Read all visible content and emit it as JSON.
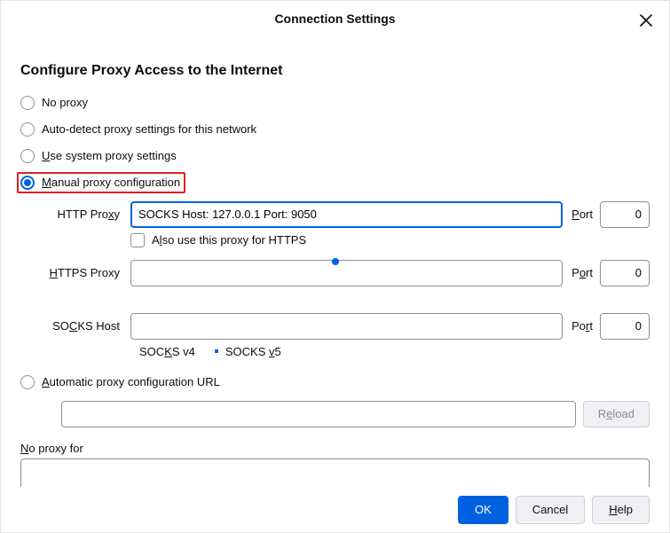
{
  "title": "Connection Settings",
  "section_title": "Configure Proxy Access to the Internet",
  "radios": {
    "noproxy": "No proxy",
    "autodetect": "Auto-detect proxy settings for this network",
    "system_pre": "U",
    "system_post": "se system proxy settings",
    "manual_pre": "M",
    "manual_post": "anual proxy configuration",
    "auto_pac_pre": "A",
    "auto_pac_post": "utomatic proxy configuration URL"
  },
  "http": {
    "label_pre": "HTTP Pro",
    "label_u": "x",
    "label_post": "y",
    "value": "SOCKS Host: 127.0.0.1 Port: 9050",
    "port_label_u": "P",
    "port_label_post": "ort",
    "port": "0"
  },
  "also_https": {
    "pre": "A",
    "u": "l",
    "post": "so use this proxy for HTTPS"
  },
  "https": {
    "label_u": "H",
    "label_post": "TTPS Proxy",
    "value": "",
    "port_label_pre": "P",
    "port_label_u": "o",
    "port_label_post": "rt",
    "port": "0"
  },
  "socks": {
    "label_pre": "SO",
    "label_u": "C",
    "label_post": "KS Host",
    "value": "",
    "port_label_pre": "Po",
    "port_label_u": "r",
    "port_label_post": "t",
    "port": "0"
  },
  "socks_ver": {
    "v4_pre": "SOC",
    "v4_u": "K",
    "v4_post": "S v4",
    "v5_pre": "SOCKS ",
    "v5_u": "v",
    "v5_post": "5"
  },
  "pac": {
    "value": "",
    "reload_pre": "R",
    "reload_u": "e",
    "reload_post": "load"
  },
  "no_proxy_for": {
    "u": "N",
    "post": "o proxy for",
    "value": ""
  },
  "footer": {
    "ok": "OK",
    "cancel": "Cancel",
    "help_u": "H",
    "help_post": "elp"
  }
}
